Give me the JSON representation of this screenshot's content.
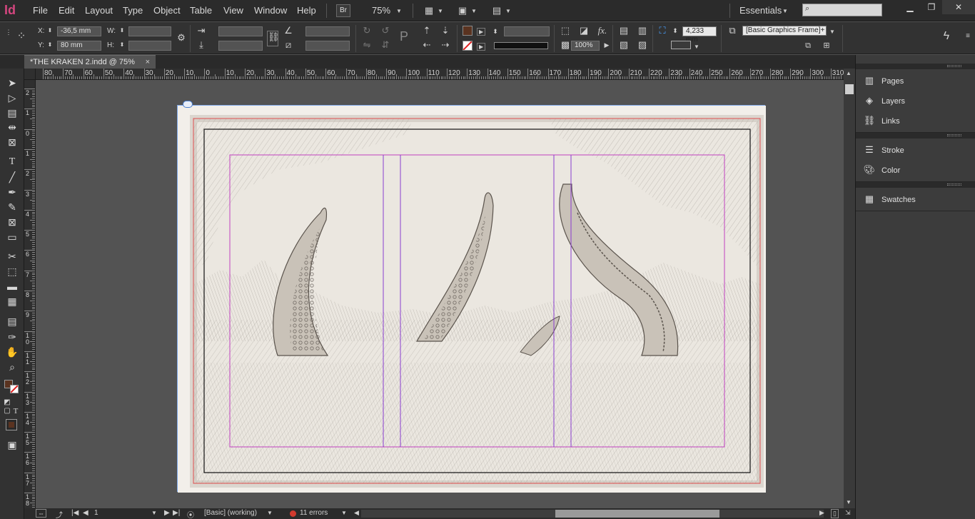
{
  "app": {
    "logo": "Id"
  },
  "menu": [
    "File",
    "Edit",
    "Layout",
    "Type",
    "Object",
    "Table",
    "View",
    "Window",
    "Help"
  ],
  "menubar": {
    "bridge_button": "Br",
    "zoom": "75%",
    "workspace": "Essentials"
  },
  "control_bar": {
    "x_label": "X:",
    "x_value": "-36,5 mm",
    "y_label": "Y:",
    "y_value": "80 mm",
    "w_label": "W:",
    "h_label": "H:",
    "stroke_weight": "4,233 mm",
    "opacity": "100%",
    "object_style": "[Basic Graphics Frame]+"
  },
  "document": {
    "tab_title": "*THE KRAKEN 2.indd @ 75%",
    "close_glyph": "×"
  },
  "ruler": {
    "h_labels": [
      "80",
      "70",
      "60",
      "50",
      "40",
      "30",
      "20",
      "10",
      "0",
      "10",
      "20",
      "30",
      "40",
      "50",
      "60",
      "70",
      "80",
      "90",
      "100",
      "110",
      "120",
      "130",
      "140",
      "150",
      "160",
      "170",
      "180",
      "190",
      "200",
      "210",
      "220",
      "230",
      "240",
      "250",
      "260",
      "270",
      "280",
      "290",
      "300",
      "310"
    ],
    "v_labels": [
      "2",
      "1",
      "0",
      "1",
      "2",
      "3",
      "4",
      "5",
      "6",
      "7",
      "8",
      "9",
      "1 0",
      "1 1",
      "1 2",
      "1 3",
      "1 4",
      "1 5",
      "1 6",
      "1 7",
      "1 8"
    ]
  },
  "status_bar": {
    "page_number": "1",
    "preflight_profile": "[Basic] (working)",
    "errors": "11 errors",
    "error_color": "#d23a2e"
  },
  "panels": {
    "group1": [
      {
        "label": "Pages",
        "icon": "pages-icon"
      },
      {
        "label": "Layers",
        "icon": "layers-icon"
      },
      {
        "label": "Links",
        "icon": "links-icon"
      }
    ],
    "group2": [
      {
        "label": "Stroke",
        "icon": "stroke-icon"
      },
      {
        "label": "Color",
        "icon": "color-icon"
      }
    ],
    "group3": [
      {
        "label": "Swatches",
        "icon": "swatches-icon"
      }
    ]
  },
  "colors": {
    "accent": "#d4467f",
    "fill_swatch": "#5a3320",
    "margin_guide": "#c040c0",
    "bleed_guide": "#e05050",
    "page_border": "#7fa8e8"
  }
}
